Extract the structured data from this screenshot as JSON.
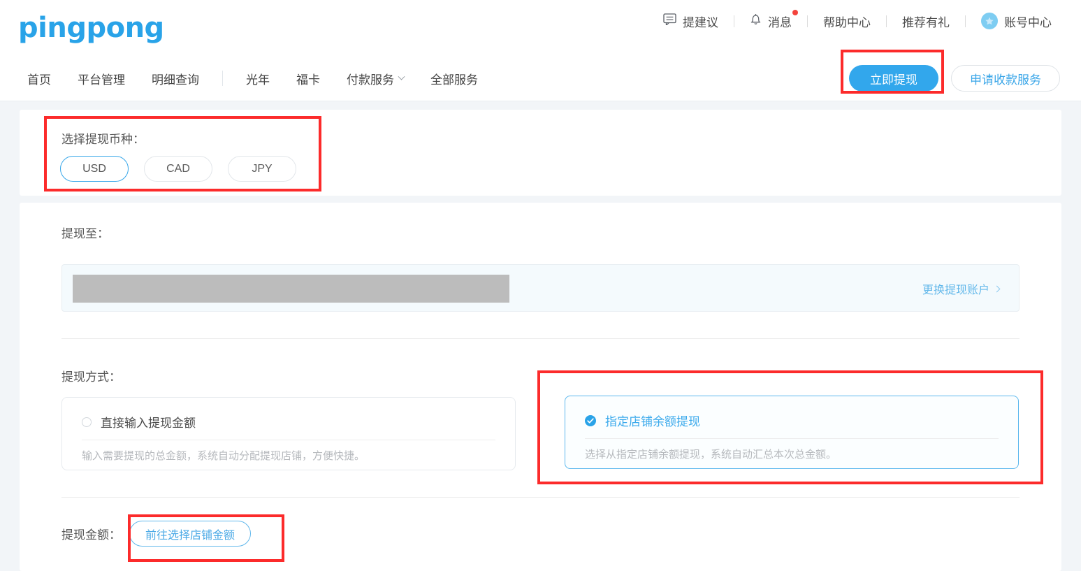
{
  "brand": {
    "logo_text": "pingpong",
    "accent": "#29a3e8"
  },
  "topbar": {
    "items": [
      {
        "label": "提建议",
        "icon": "chat-bubble-icon",
        "badge": false
      },
      {
        "label": "消息",
        "icon": "bell-icon",
        "badge": true
      },
      {
        "label": "帮助中心",
        "icon": null,
        "badge": false
      },
      {
        "label": "推荐有礼",
        "icon": null,
        "badge": false
      },
      {
        "label": "账号中心",
        "icon": "star-avatar-icon",
        "badge": false
      }
    ]
  },
  "subnav": {
    "items": [
      {
        "label": "首页",
        "has_chevron": false
      },
      {
        "label": "平台管理",
        "has_chevron": false
      },
      {
        "label": "明细查询",
        "has_chevron": false
      },
      {
        "label": "光年",
        "has_chevron": false
      },
      {
        "label": "福卡",
        "has_chevron": false
      },
      {
        "label": "付款服务",
        "has_chevron": true
      },
      {
        "label": "全部服务",
        "has_chevron": false
      }
    ],
    "primary_button": "立即提现",
    "outline_button": "申请收款服务"
  },
  "currency_section": {
    "label": "选择提现币种：",
    "options": [
      {
        "code": "USD",
        "selected": true
      },
      {
        "code": "CAD",
        "selected": false
      },
      {
        "code": "JPY",
        "selected": false
      }
    ]
  },
  "withdraw_to": {
    "label": "提现至：",
    "account_masked": "",
    "change_link": "更换提现账户"
  },
  "withdraw_method": {
    "label": "提现方式：",
    "options": [
      {
        "title": "直接输入提现金额",
        "desc": "输入需要提现的总金额，系统自动分配提现店铺，方便快捷。",
        "selected": false
      },
      {
        "title": "指定店铺余额提现",
        "desc": "选择从指定店铺余额提现，系统自动汇总本次总金额。",
        "selected": true
      }
    ]
  },
  "withdraw_amount": {
    "label": "提现金额：",
    "button": "前往选择店铺金额"
  },
  "annotations": {
    "color": "#fc2b2b",
    "count": 4
  }
}
